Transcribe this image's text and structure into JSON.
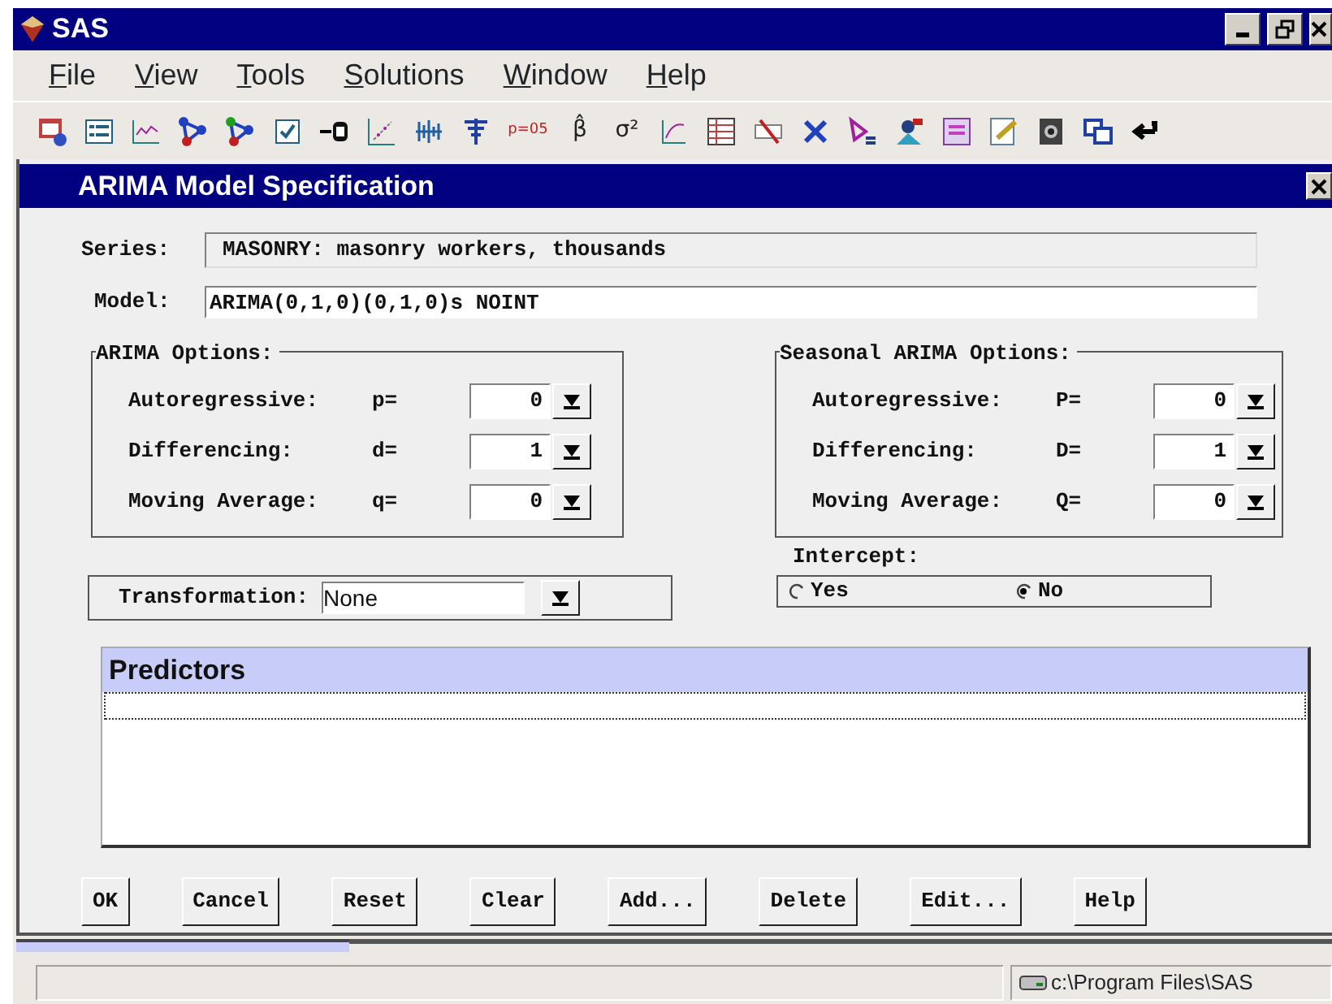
{
  "window": {
    "title": "SAS"
  },
  "menu": [
    {
      "label": "File"
    },
    {
      "label": "View"
    },
    {
      "label": "Tools"
    },
    {
      "label": "Solutions"
    },
    {
      "label": "Window"
    },
    {
      "label": "Help"
    }
  ],
  "toolbar": [
    {
      "kind": "icon"
    },
    {
      "kind": "icon"
    },
    {
      "kind": "icon"
    },
    {
      "kind": "icon"
    },
    {
      "kind": "icon"
    },
    {
      "kind": "icon"
    },
    {
      "kind": "icon"
    },
    {
      "kind": "icon"
    },
    {
      "kind": "icon"
    },
    {
      "kind": "icon"
    },
    {
      "kind": "text",
      "text": "p=05"
    },
    {
      "kind": "text",
      "text": "β̂"
    },
    {
      "kind": "text",
      "text": "σ²"
    },
    {
      "kind": "icon"
    },
    {
      "kind": "icon"
    },
    {
      "kind": "icon"
    },
    {
      "kind": "icon"
    },
    {
      "kind": "icon"
    },
    {
      "kind": "icon"
    },
    {
      "kind": "icon"
    },
    {
      "kind": "icon"
    },
    {
      "kind": "icon"
    },
    {
      "kind": "icon"
    },
    {
      "kind": "icon"
    }
  ],
  "dialog": {
    "title": "ARIMA Model Specification",
    "series": {
      "label": "Series:",
      "value": "MASONRY: masonry workers, thousands"
    },
    "model": {
      "label": "Model:",
      "value": "ARIMA(0,1,0)(0,1,0)s NOINT"
    },
    "arima_options": {
      "title": "ARIMA Options:",
      "rows": [
        {
          "label": "Autoregressive:",
          "param": "p=",
          "value": "0"
        },
        {
          "label": "Differencing:",
          "param": "d=",
          "value": "1"
        },
        {
          "label": "Moving Average:",
          "param": "q=",
          "value": "0"
        }
      ]
    },
    "seasonal_arima_options": {
      "title": "Seasonal ARIMA Options:",
      "rows": [
        {
          "label": "Autoregressive:",
          "param": "P=",
          "value": "0"
        },
        {
          "label": "Differencing:",
          "param": "D=",
          "value": "1"
        },
        {
          "label": "Moving Average:",
          "param": "Q=",
          "value": "0"
        }
      ]
    },
    "transformation": {
      "label": "Transformation:",
      "value": "None"
    },
    "intercept": {
      "label": "Intercept:",
      "options": [
        {
          "label": "Yes",
          "selected": false
        },
        {
          "label": "No",
          "selected": true
        }
      ]
    },
    "predictors": {
      "title": "Predictors"
    },
    "buttons": [
      "OK",
      "Cancel",
      "Reset",
      "Clear",
      "Add...",
      "Delete",
      "Edit...",
      "Help"
    ]
  },
  "status_bar": {
    "path": "c:\\Program Files\\SAS"
  }
}
